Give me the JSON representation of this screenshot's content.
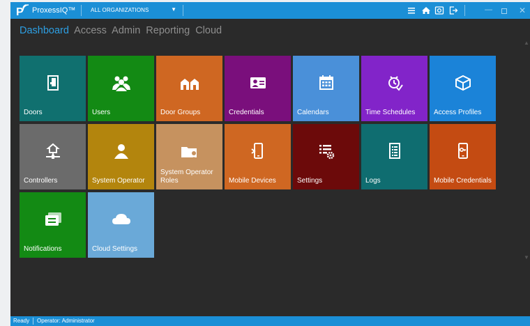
{
  "titlebar": {
    "app_title": "ProxessIQ™",
    "org_select": "ALL ORGANIZATIONS",
    "icons": [
      "menu-icon",
      "home-icon",
      "camera-icon",
      "logout-icon"
    ]
  },
  "nav": {
    "items": [
      "Dashboard",
      "Access",
      "Admin",
      "Reporting",
      "Cloud"
    ],
    "active": "Dashboard"
  },
  "tiles": [
    {
      "label": "Doors",
      "color": "#10706f",
      "icon": "door-icon"
    },
    {
      "label": "Users",
      "color": "#138a14",
      "icon": "users-icon"
    },
    {
      "label": "Door Groups",
      "color": "#cf6722",
      "icon": "door-groups-icon"
    },
    {
      "label": "Credentials",
      "color": "#7a0f7c",
      "icon": "id-card-icon"
    },
    {
      "label": "Calendars",
      "color": "#4a90d9",
      "icon": "calendar-icon"
    },
    {
      "label": "Time Schedules",
      "color": "#8224c9",
      "icon": "clock-icon"
    },
    {
      "label": "Access Profiles",
      "color": "#1b83d8",
      "icon": "cube-icon"
    },
    {
      "label": "Controllers",
      "color": "#6b6b6b",
      "icon": "controller-icon"
    },
    {
      "label": "System Operator",
      "color": "#b3850d",
      "icon": "person-icon"
    },
    {
      "label": "System Operator Roles",
      "color": "#c6925f",
      "icon": "operator-roles-icon"
    },
    {
      "label": "Mobile Devices",
      "color": "#cf6722",
      "icon": "mobile-icon"
    },
    {
      "label": "Settings",
      "color": "#6c0a0a",
      "icon": "settings-icon"
    },
    {
      "label": "Logs",
      "color": "#0f6d70",
      "icon": "logs-icon"
    },
    {
      "label": "Mobile Credentials",
      "color": "#c44b12",
      "icon": "mobile-key-icon"
    },
    {
      "label": "Notifications",
      "color": "#138a14",
      "icon": "notifications-icon"
    },
    {
      "label": "Cloud Settings",
      "color": "#6aa9d8",
      "icon": "cloud-icon"
    }
  ],
  "statusbar": {
    "state": "Ready",
    "operator": "Operator: Administrator"
  }
}
